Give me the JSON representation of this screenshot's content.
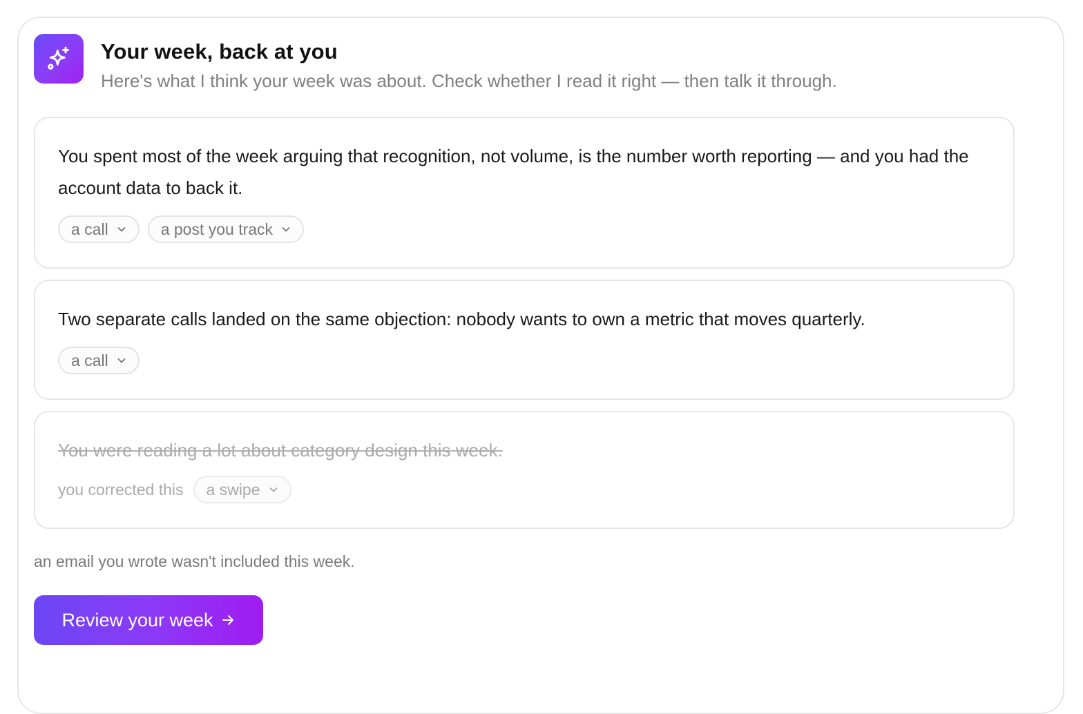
{
  "header": {
    "icon": "sparkles-icon",
    "title": "Your week, back at you",
    "subtitle": "Here's what I think your week was about. Check whether I read it right — then talk it through."
  },
  "items": [
    {
      "text": "You spent most of the week arguing that recognition, not volume, is the number worth reporting — and you had the account data to back it.",
      "corrected": false,
      "sources": [
        "a call",
        "a post you track"
      ]
    },
    {
      "text": "Two separate calls landed on the same objection: nobody wants to own a metric that moves quarterly.",
      "corrected": false,
      "sources": [
        "a call"
      ]
    },
    {
      "text": "You were reading a lot about category design this week.",
      "corrected": true,
      "corrected_label": "you corrected this",
      "sources": [
        "a swipe"
      ]
    }
  ],
  "footnote": "an email you wrote wasn't included this week.",
  "cta": {
    "label": "Review your week",
    "icon": "arrow-right-icon"
  },
  "colors": {
    "accent_start": "#6c47f3",
    "accent_end": "#a01cf2",
    "border": "#e6e6e6",
    "muted_text": "#808080"
  }
}
